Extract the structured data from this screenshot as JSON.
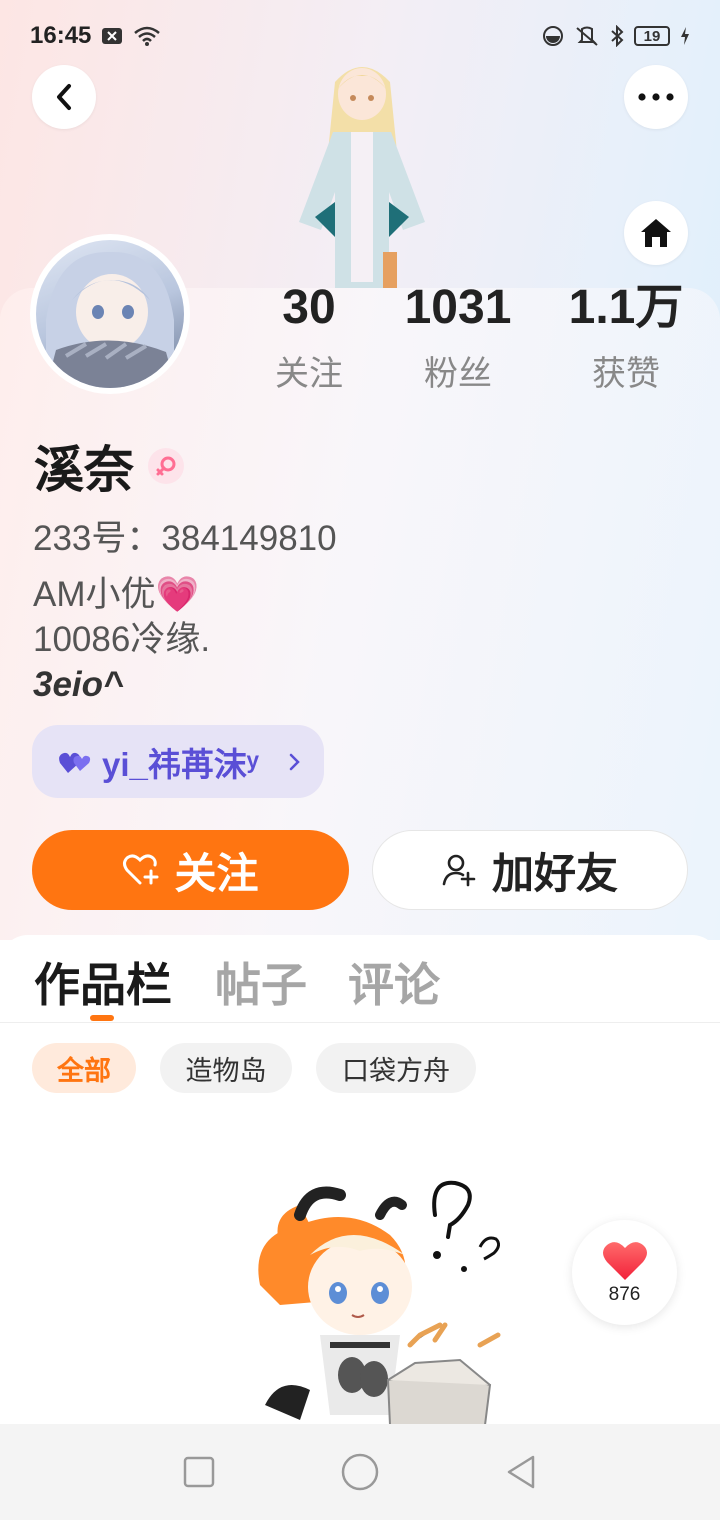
{
  "status_bar": {
    "time": "16:45",
    "battery": "19"
  },
  "stats": [
    {
      "value": "30",
      "label": "关注"
    },
    {
      "value": "1031",
      "label": "粉丝"
    },
    {
      "value": "1.1万",
      "label": "获赞"
    }
  ],
  "profile": {
    "name": "溪奈",
    "uid": "233号：384149810",
    "bio": [
      "AM小优💗",
      "10086冷缘.",
      "3eio^"
    ]
  },
  "cp_pill": {
    "label": "yi_祎苒沫ʸ"
  },
  "actions": {
    "follow": "关注",
    "add_friend": "加好友"
  },
  "tabs": [
    "作品栏",
    "帖子",
    "评论"
  ],
  "filters": [
    "全部",
    "造物岛",
    "口袋方舟"
  ],
  "like_fab": {
    "count": "876"
  },
  "colors": {
    "accent": "#ff7511",
    "pill_text": "#5a4fd6"
  }
}
